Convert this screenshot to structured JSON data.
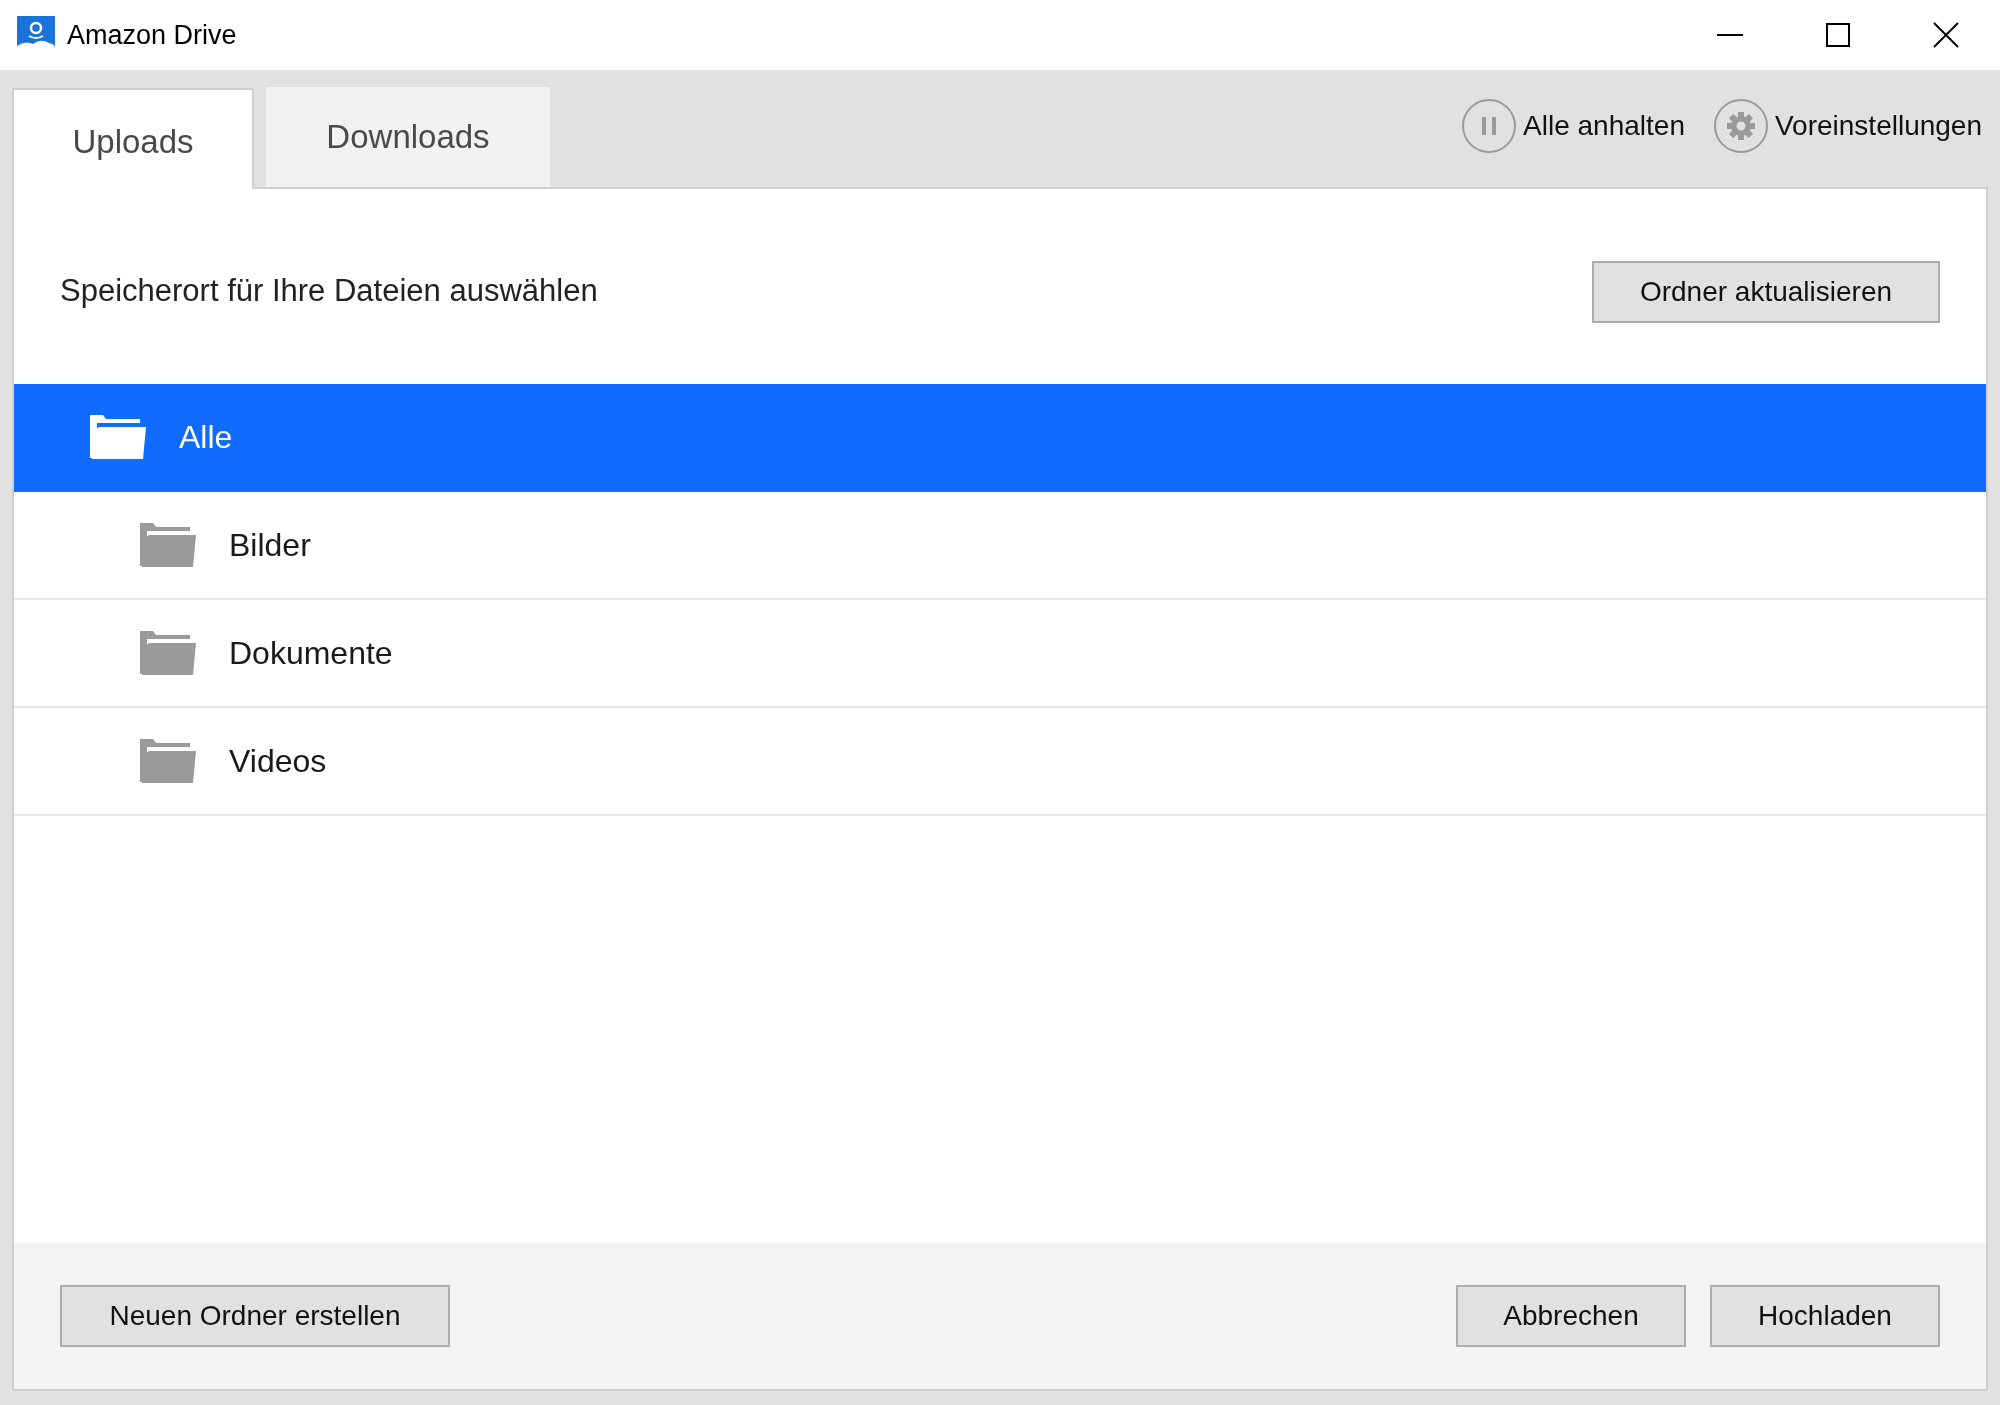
{
  "window": {
    "title": "Amazon Drive"
  },
  "tabs": [
    {
      "label": "Uploads",
      "selected": true
    },
    {
      "label": "Downloads",
      "selected": false
    }
  ],
  "toolbar": [
    {
      "kind": "pause",
      "label": "Alle anhalten"
    },
    {
      "kind": "settings",
      "label": "Voreinstellungen"
    }
  ],
  "heading": "Speicherort für Ihre Dateien auswählen",
  "refresh_button": "Ordner aktualisieren",
  "folders": [
    {
      "name": "Alle",
      "selected": true,
      "children": [
        {
          "name": "Bilder",
          "selected": false
        },
        {
          "name": "Dokumente",
          "selected": false
        },
        {
          "name": "Videos",
          "selected": false
        }
      ]
    }
  ],
  "footer": {
    "new_folder_button": "Neuen Ordner erstellen",
    "buttons": [
      "Abbrechen",
      "Hochladen"
    ]
  }
}
